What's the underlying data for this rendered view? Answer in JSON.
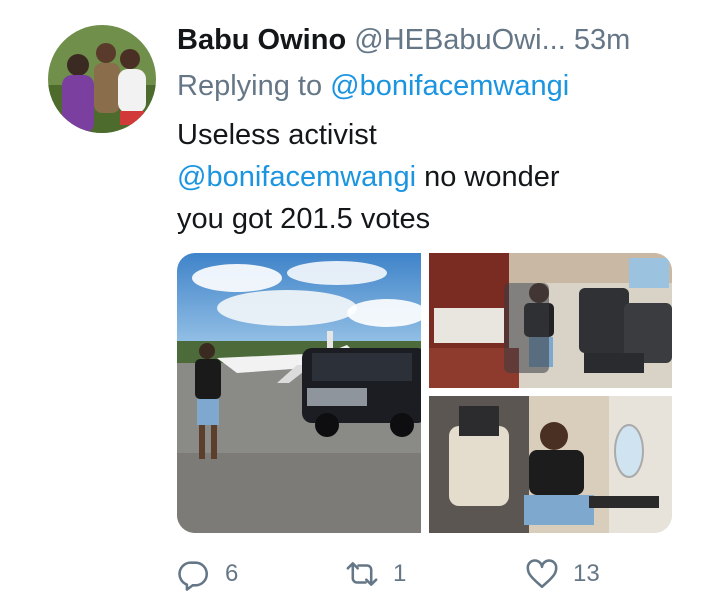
{
  "tweet": {
    "author_name": "Babu Owino",
    "author_handle": "@HEBabuOwi...",
    "timestamp": "53m",
    "replying_prefix": "Replying to",
    "replying_handle": "@bonifacemwangi",
    "text_line1": "Useless activist",
    "text_mention": "@bonifacemwangi",
    "text_line2_rest": " no wonder",
    "text_line3": "you got 201.5 votes"
  },
  "actions": {
    "reply_count": "6",
    "retweet_count": "1",
    "like_count": "13"
  },
  "colors": {
    "link": "#1b95e0",
    "secondary_text": "#657786",
    "primary_text": "#14171a"
  }
}
